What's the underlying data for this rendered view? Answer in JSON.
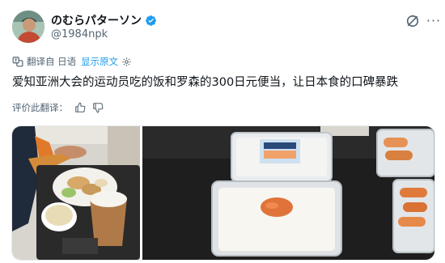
{
  "author": {
    "display_name": "のむらパターソン",
    "handle": "@1984npk",
    "verified": true
  },
  "header_icons": [
    "grok-icon",
    "more-icon"
  ],
  "translation": {
    "translated_from_label": "翻译自 日语",
    "show_original_label": "显示原文"
  },
  "tweet": {
    "text": "爱知亚洲大会的运动员吃的饭和罗森的300日元便当，让日本食的口碑暴跌"
  },
  "rating": {
    "prompt_label": "评价此翻译："
  },
  "media": {
    "photos": [
      {
        "subject": "athlete-meal-tray"
      },
      {
        "subject": "lawson-bento-boxes"
      }
    ]
  },
  "colors": {
    "accent": "#1d9bf0",
    "text_primary": "#0f1419",
    "text_secondary": "#536471"
  }
}
